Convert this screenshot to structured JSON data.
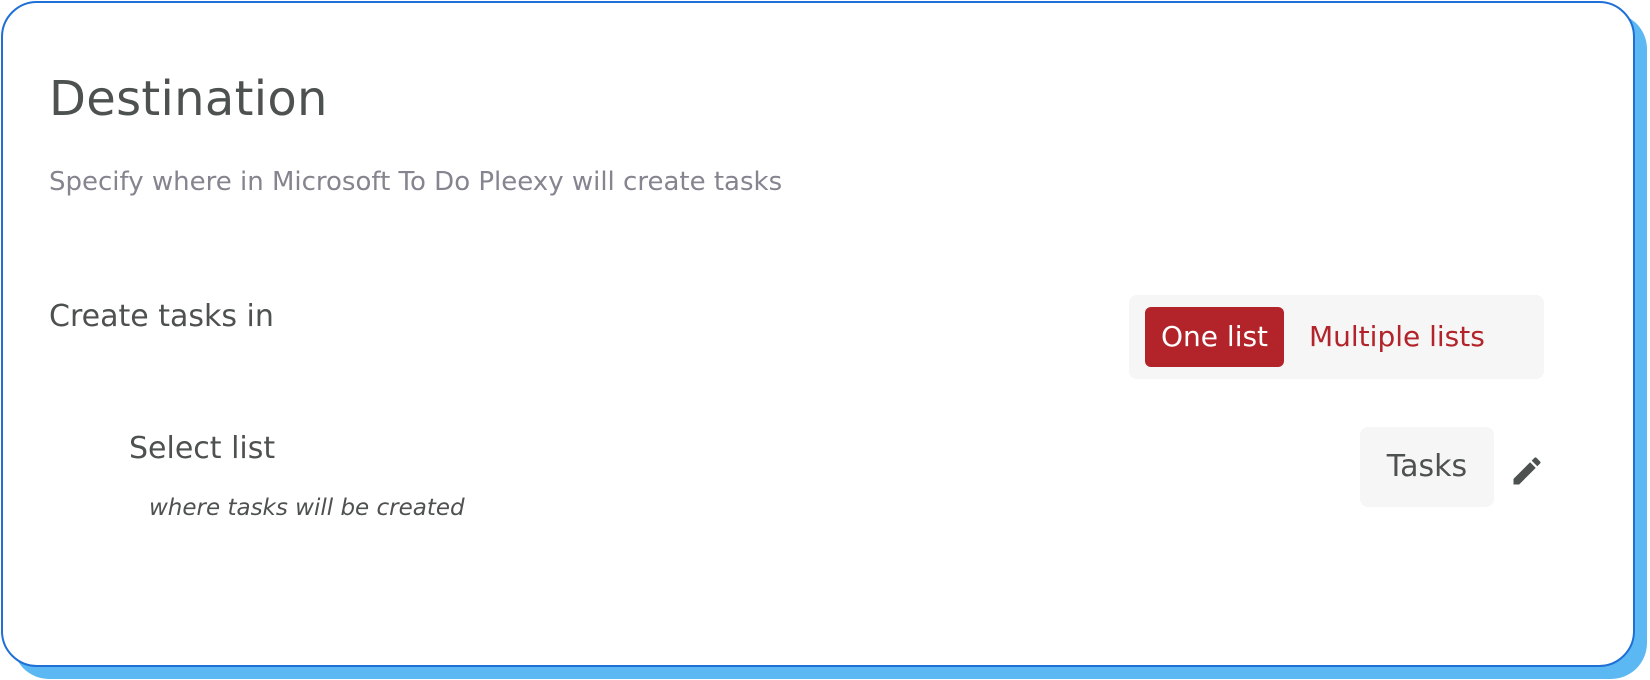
{
  "destination": {
    "title": "Destination",
    "subtitle": "Specify where in Microsoft To Do Pleexy will create tasks"
  },
  "create_tasks": {
    "label": "Create tasks in",
    "options": [
      {
        "label": "One list",
        "selected": true
      },
      {
        "label": "Multiple lists",
        "selected": false
      }
    ]
  },
  "select_list": {
    "label": "Select list",
    "hint": "where tasks will be created",
    "selected_value": "Tasks",
    "edit_icon": "pencil-icon"
  },
  "colors": {
    "accent": "#b2242a",
    "card_border": "#1f6fd6",
    "card_shadow": "#5bb8f2",
    "text_primary": "#4d5150",
    "text_muted": "#85848f",
    "chip_background": "#f6f6f6"
  }
}
